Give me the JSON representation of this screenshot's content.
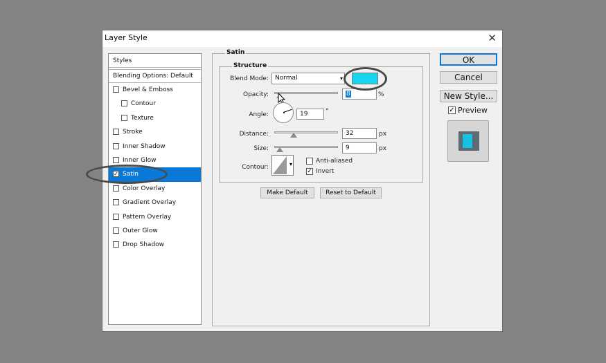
{
  "window": {
    "title": "Layer Style",
    "close_glyph": "✕"
  },
  "styles_panel": {
    "header": "Styles",
    "blending": "Blending Options: Default",
    "items": [
      {
        "label": "Bevel & Emboss",
        "checked": false,
        "indent": false
      },
      {
        "label": "Contour",
        "checked": false,
        "indent": true
      },
      {
        "label": "Texture",
        "checked": false,
        "indent": true
      },
      {
        "label": "Stroke",
        "checked": false,
        "indent": false
      },
      {
        "label": "Inner Shadow",
        "checked": false,
        "indent": false
      },
      {
        "label": "Inner Glow",
        "checked": false,
        "indent": false
      },
      {
        "label": "Satin",
        "checked": true,
        "indent": false,
        "selected": true
      },
      {
        "label": "Color Overlay",
        "checked": false,
        "indent": false
      },
      {
        "label": "Gradient Overlay",
        "checked": false,
        "indent": false
      },
      {
        "label": "Pattern Overlay",
        "checked": false,
        "indent": false
      },
      {
        "label": "Outer Glow",
        "checked": false,
        "indent": false
      },
      {
        "label": "Drop Shadow",
        "checked": false,
        "indent": false
      }
    ]
  },
  "satin": {
    "group_title": "Satin",
    "structure_title": "Structure",
    "blend_mode_label": "Blend Mode:",
    "blend_mode_value": "Normal",
    "satin_color": "#16d6ef",
    "opacity_label": "Opacity:",
    "opacity_value": "8",
    "opacity_unit": "%",
    "angle_label": "Angle:",
    "angle_value": "19",
    "angle_unit": "°",
    "distance_label": "Distance:",
    "distance_value": "32",
    "distance_unit": "px",
    "size_label": "Size:",
    "size_value": "9",
    "size_unit": "px",
    "contour_label": "Contour:",
    "anti_aliased_label": "Anti-aliased",
    "anti_aliased_checked": false,
    "invert_label": "Invert",
    "invert_checked": true,
    "make_default": "Make Default",
    "reset_default": "Reset to Default"
  },
  "right_panel": {
    "ok": "OK",
    "cancel": "Cancel",
    "new_style": "New Style...",
    "preview_label": "Preview",
    "preview_checked": true,
    "preview_color": "#16c2e0"
  }
}
